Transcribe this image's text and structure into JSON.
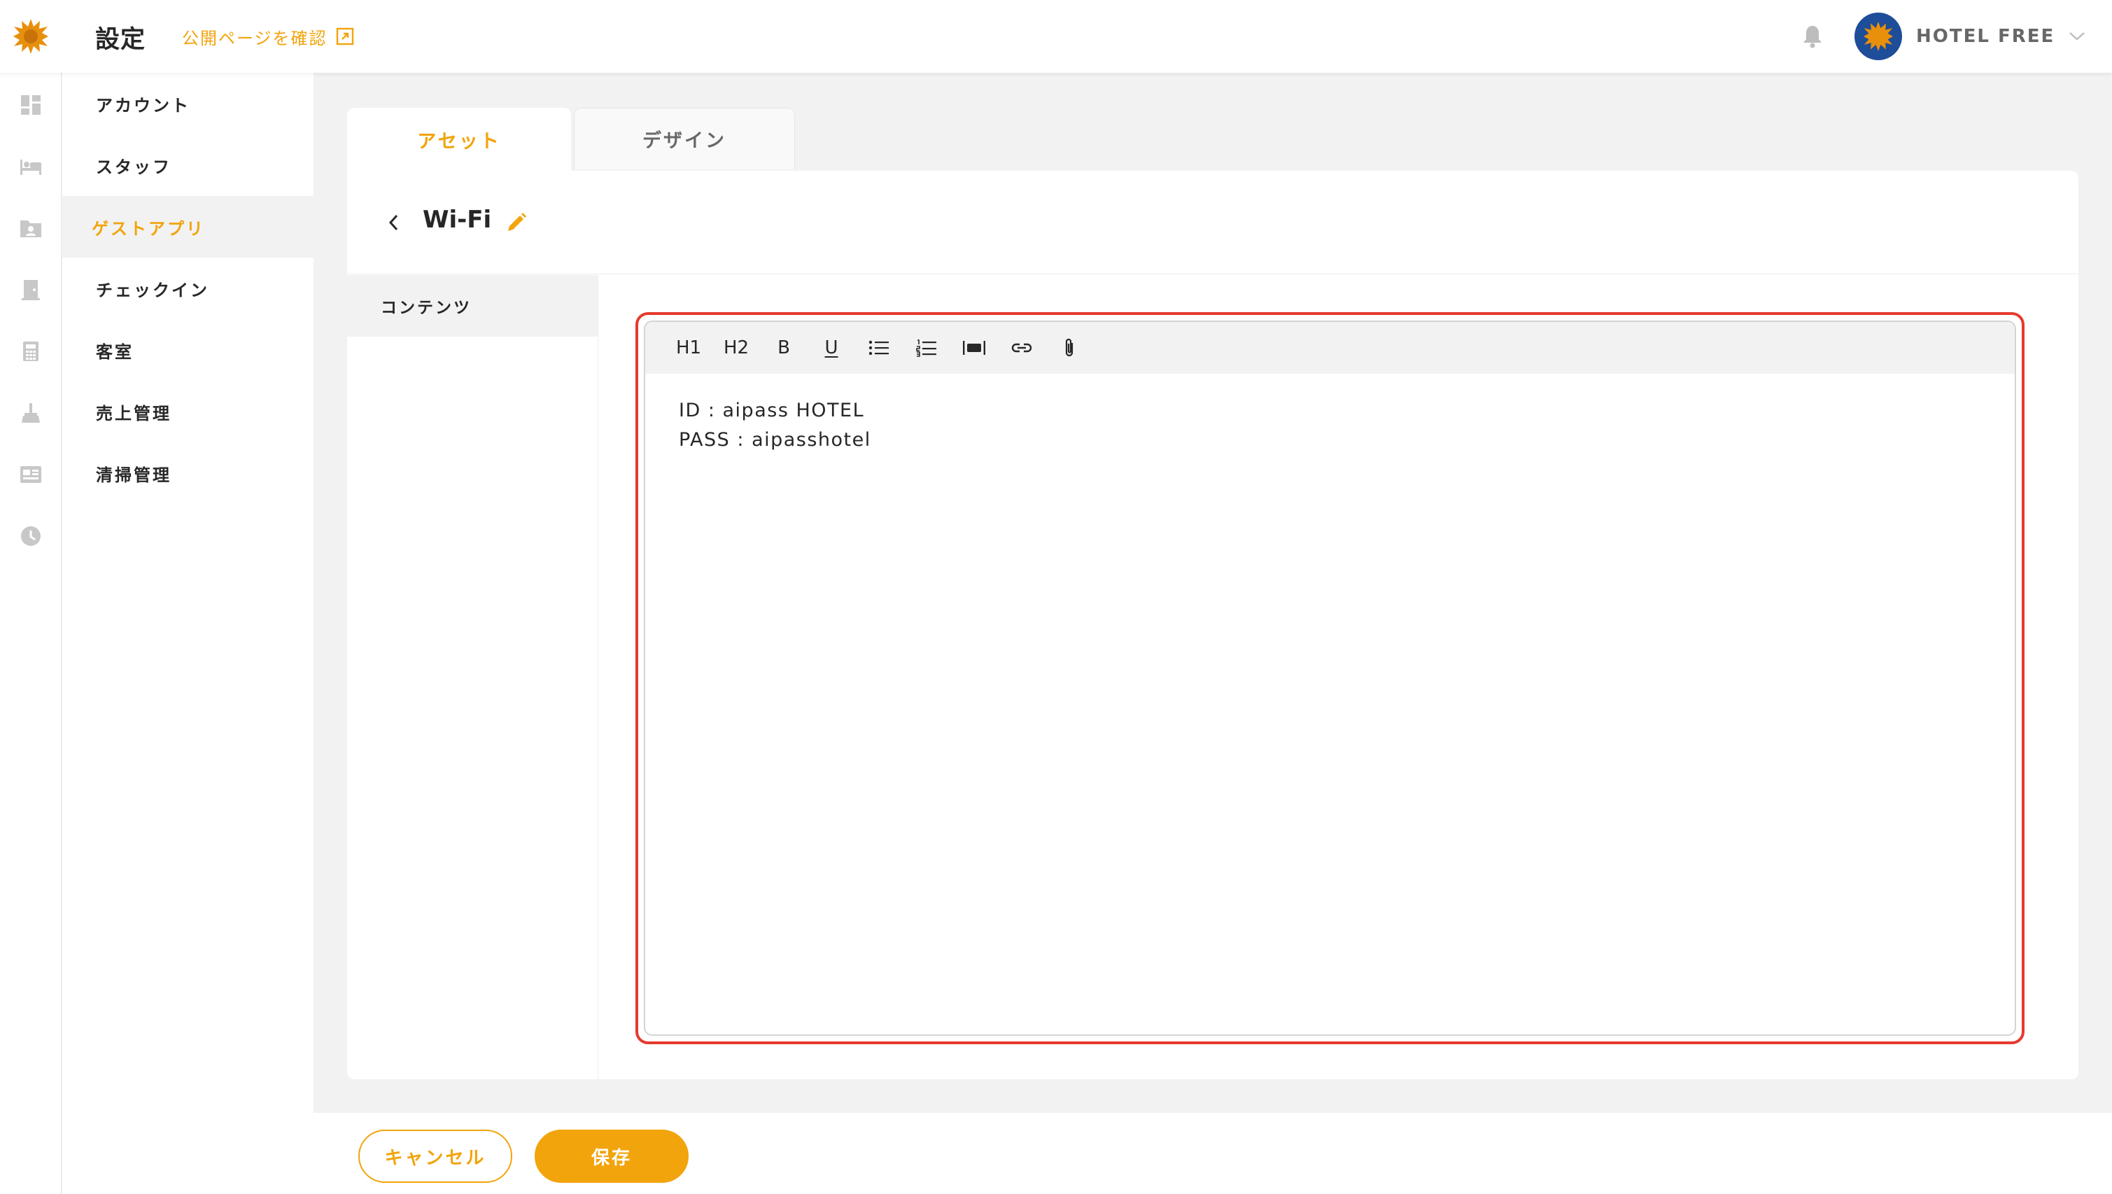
{
  "header": {
    "title": "設定",
    "public_link": "公開ページを確認",
    "account_name": "HOTEL FREE",
    "brand_color": "#f2a40c"
  },
  "rail": {
    "icons": [
      "dashboard-icon",
      "bed-icon",
      "guest-folder-icon",
      "door-icon",
      "calculator-icon",
      "broom-icon",
      "news-icon",
      "clock-icon"
    ]
  },
  "menu": {
    "items": [
      {
        "label": "アカウント"
      },
      {
        "label": "スタッフ"
      },
      {
        "label": "ゲストアプリ",
        "active": true
      },
      {
        "label": "チェックイン"
      },
      {
        "label": "客室"
      },
      {
        "label": "売上管理"
      },
      {
        "label": "清掃管理"
      }
    ]
  },
  "tabs": {
    "asset": "アセット",
    "design": "デザイン"
  },
  "panel": {
    "title": "Wi-Fi",
    "side_item": "コンテンツ"
  },
  "toolbar": {
    "h1": "H1",
    "h2": "H2",
    "bold": "B",
    "underline": "U"
  },
  "editor": {
    "line1": "ID : aipass HOTEL",
    "line2": "PASS : aipasshotel"
  },
  "footer": {
    "cancel": "キャンセル",
    "save": "保存"
  }
}
